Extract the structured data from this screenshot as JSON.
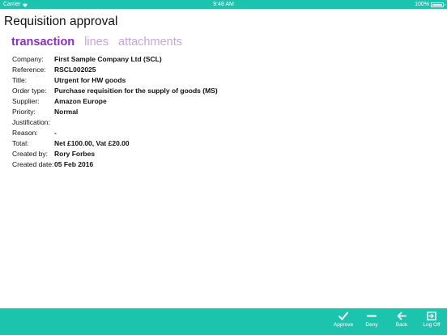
{
  "status_bar": {
    "carrier": "Carrier",
    "time": "9:48 AM",
    "battery": "100%",
    "battery_level": 1.0
  },
  "page": {
    "title": "Requisition approval"
  },
  "tabs": [
    {
      "label": "transaction",
      "active": true
    },
    {
      "label": "lines",
      "active": false
    },
    {
      "label": "attachments",
      "active": false
    }
  ],
  "details": [
    {
      "label": "Company:",
      "value": "First Sample Company Ltd (SCL)"
    },
    {
      "label": "Reference:",
      "value": "RSCL002025"
    },
    {
      "label": "Title:",
      "value": "Utrgent for HW goods"
    },
    {
      "label": "Order type:",
      "value": "Purchase requisition for the supply of goods (MS)"
    },
    {
      "label": "Supplier:",
      "value": "Amazon Europe"
    },
    {
      "label": "Priority:",
      "value": "Normal"
    },
    {
      "label": "Justification:",
      "value": ""
    },
    {
      "label": "Reason:",
      "value": "-"
    },
    {
      "label": "Total:",
      "value": "Net £100.00, Vat £20.00"
    },
    {
      "label": "Created by:",
      "value": "Rory Forbes"
    },
    {
      "label": "Created date:",
      "value": "05 Feb 2016"
    }
  ],
  "toolbar": {
    "approve_label": "Approve",
    "deny_label": "Deny",
    "back_label": "Back",
    "logoff_label": "Log Off"
  },
  "colors": {
    "accent": "#1cc4ae",
    "tab_active": "#8a2fc7",
    "tab_inactive": "#c9a4e6"
  },
  "icons": {
    "approve": "check-icon",
    "deny": "minus-icon",
    "back": "arrow-left-icon",
    "logoff": "logout-icon"
  }
}
